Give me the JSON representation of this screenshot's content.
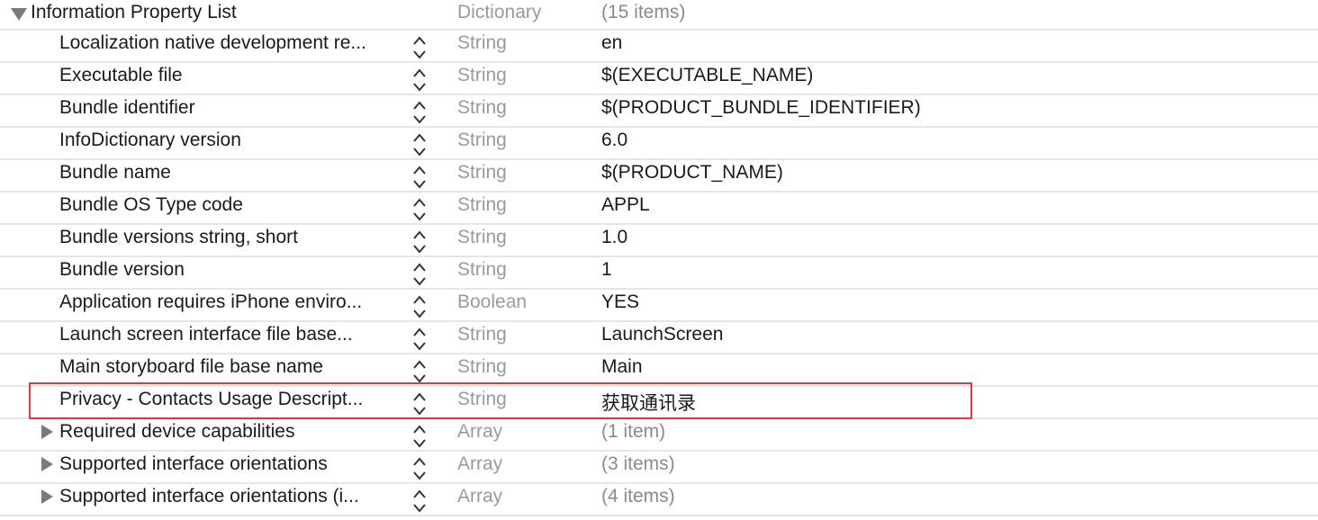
{
  "root": {
    "key": "Information Property List",
    "type": "Dictionary",
    "value": "(15 items)",
    "expanded": true
  },
  "rows": [
    {
      "key": "Localization native development re...",
      "type": "String",
      "value": "en"
    },
    {
      "key": "Executable file",
      "type": "String",
      "value": "$(EXECUTABLE_NAME)"
    },
    {
      "key": "Bundle identifier",
      "type": "String",
      "value": "$(PRODUCT_BUNDLE_IDENTIFIER)"
    },
    {
      "key": "InfoDictionary version",
      "type": "String",
      "value": "6.0"
    },
    {
      "key": "Bundle name",
      "type": "String",
      "value": "$(PRODUCT_NAME)"
    },
    {
      "key": "Bundle OS Type code",
      "type": "String",
      "value": "APPL"
    },
    {
      "key": "Bundle versions string, short",
      "type": "String",
      "value": "1.0"
    },
    {
      "key": "Bundle version",
      "type": "String",
      "value": "1"
    },
    {
      "key": "Application requires iPhone enviro...",
      "type": "Boolean",
      "value": "YES"
    },
    {
      "key": "Launch screen interface file base...",
      "type": "String",
      "value": "LaunchScreen"
    },
    {
      "key": "Main storyboard file base name",
      "type": "String",
      "value": "Main"
    },
    {
      "key": "Privacy - Contacts Usage Descript...",
      "type": "String",
      "value": "获取通讯录",
      "highlighted": true
    },
    {
      "key": "Required device capabilities",
      "type": "Array",
      "value": "(1 item)",
      "collapsed": true
    },
    {
      "key": "Supported interface orientations",
      "type": "Array",
      "value": "(3 items)",
      "collapsed": true
    },
    {
      "key": "Supported interface orientations (i...",
      "type": "Array",
      "value": "(4 items)",
      "collapsed": true
    }
  ],
  "colors": {
    "highlight_border": "#e0383e",
    "type_text": "#9a9a9a",
    "separator": "#e6e6e6"
  }
}
